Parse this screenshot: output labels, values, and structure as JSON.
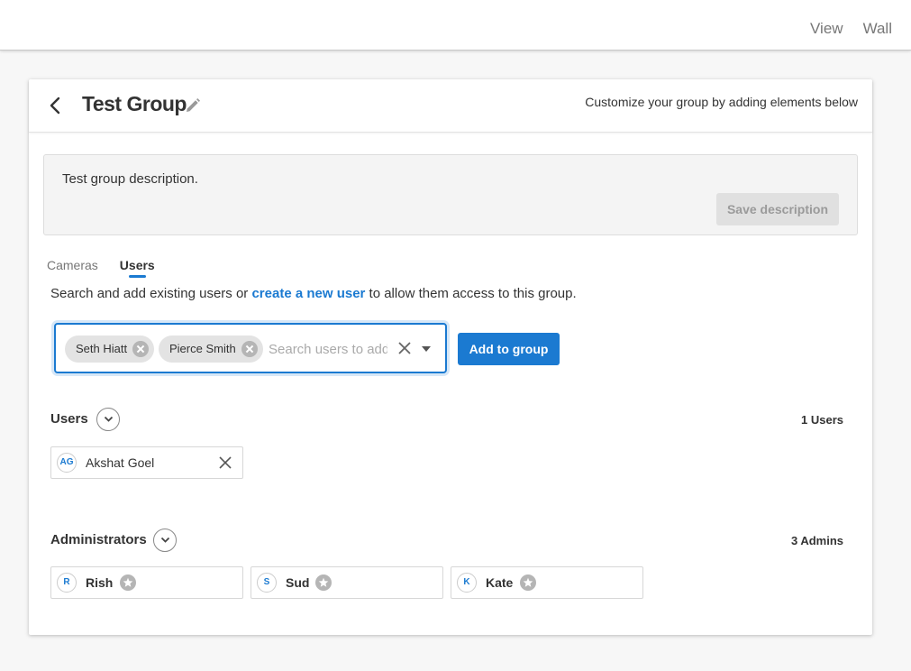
{
  "topnav": {
    "items": [
      "View",
      "Wall"
    ]
  },
  "header": {
    "title": "Test Group",
    "hint": "Customize your group by adding elements below"
  },
  "description": {
    "text": "Test group description.",
    "save_label": "Save description"
  },
  "tabs": [
    {
      "label": "Cameras",
      "active": false
    },
    {
      "label": "Users",
      "active": true
    }
  ],
  "intro": {
    "before": "Search and add existing users or ",
    "link": "create a new user",
    "after": " to allow them access to this group."
  },
  "picker": {
    "chips": [
      "Seth Hiatt",
      "Pierce Smith"
    ],
    "placeholder": "Search users to add",
    "value": ""
  },
  "add_label": "Add to group",
  "users": {
    "title": "Users",
    "count": "1 Users",
    "members": [
      {
        "initials": "AG",
        "name": "Akshat Goel"
      }
    ]
  },
  "admins": {
    "title": "Administrators",
    "count": "3 Admins",
    "members": [
      {
        "initials": "R",
        "name": "Rish"
      },
      {
        "initials": "S",
        "name": "Sud"
      },
      {
        "initials": "K",
        "name": "Kate"
      }
    ]
  },
  "icons": [
    "back-icon",
    "pencil-icon",
    "chip-remove-icon",
    "clear-icon",
    "caret-down-icon",
    "chevron-down-icon",
    "remove-icon",
    "star-icon"
  ],
  "colors": {
    "accent": "#1b7ad1",
    "chip": "#e3e3e3",
    "disabled": "#e0e0e0"
  }
}
